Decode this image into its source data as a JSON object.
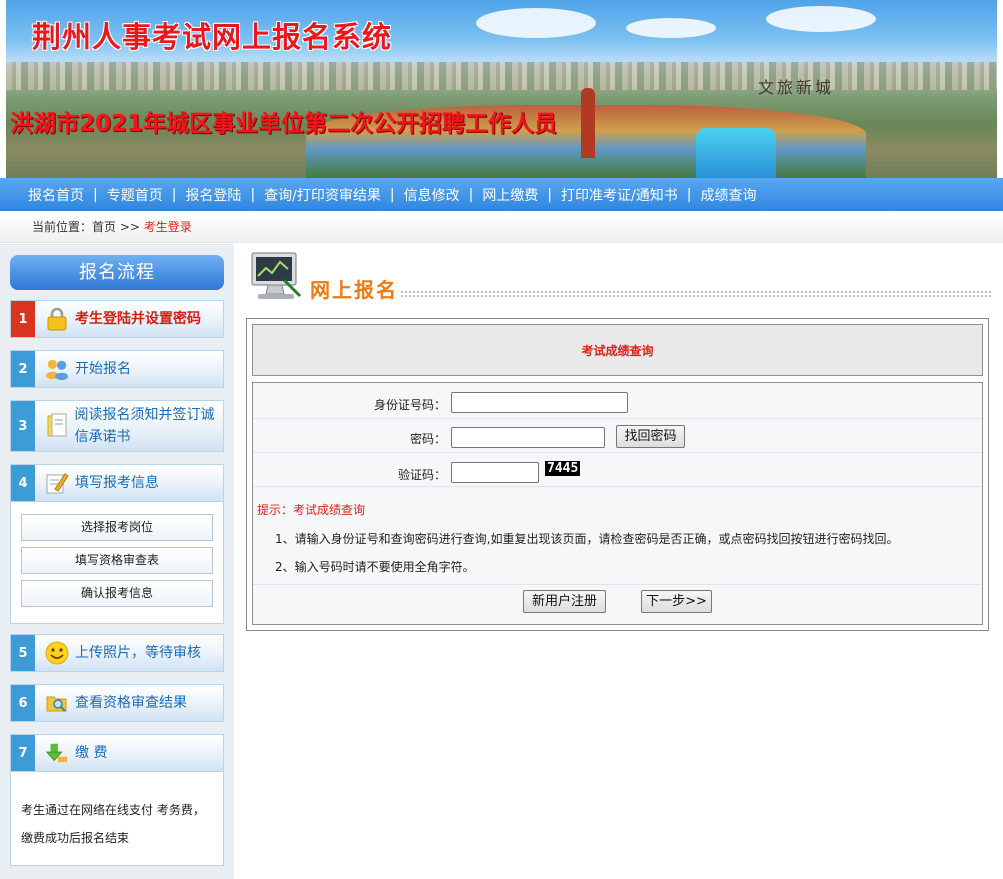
{
  "banner": {
    "system_title": "荆州人事考试网上报名系统",
    "exam_title": "洪湖市2021年城区事业单位第二次公开招聘工作人员",
    "brand_text": "文旅新城"
  },
  "nav": {
    "items": [
      "报名首页",
      "专题首页",
      "报名登陆",
      "查询/打印资审结果",
      "信息修改",
      "网上缴费",
      "打印准考证/通知书",
      "成绩查询"
    ],
    "separator": "|"
  },
  "breadcrumb": {
    "prefix": "当前位置：",
    "home": "首页",
    "arrow": " >> ",
    "current": "考生登录"
  },
  "sidebar": {
    "title": "报名流程",
    "steps": [
      {
        "num": "1",
        "label": "考生登陆并设置密码",
        "icon": "lock-icon"
      },
      {
        "num": "2",
        "label": "开始报名",
        "icon": "users-icon"
      },
      {
        "num": "3",
        "label": "阅读报名须知并签订诚信承诺书",
        "icon": "document-icon"
      },
      {
        "num": "4",
        "label": "填写报考信息",
        "icon": "edit-icon"
      },
      {
        "num": "5",
        "label": "上传照片，等待审核",
        "icon": "smiley-icon"
      },
      {
        "num": "6",
        "label": "查看资格审查结果",
        "icon": "folder-search-icon"
      },
      {
        "num": "7",
        "label": "缴 费",
        "icon": "download-arrow-icon"
      }
    ],
    "step4_buttons": [
      "选择报考岗位",
      "填写资格审查表",
      "确认报考信息"
    ],
    "pay_text": "考生通过在网络在线支付 考务费，缴费成功后报名结束"
  },
  "main": {
    "title": "网上报名",
    "panel_title": "考试成绩查询",
    "form": {
      "id_label": "身份证号码：",
      "id_value": "",
      "password_label": "密码：",
      "password_value": "",
      "find_password_button": "找回密码",
      "captcha_label": "验证码：",
      "captcha_value": "",
      "captcha_code": "7445"
    },
    "tip_label": "提示：考试成绩查询",
    "notes": [
      "1、请输入身份证号和查询密码进行查询,如重复出现该页面，请检查密码是否正确，或点密码找回按钮进行密码找回。",
      "2、输入号码时请不要使用全角字符。"
    ],
    "register_button": "新用户注册",
    "next_button": "下一步>>"
  },
  "colors": {
    "nav_blue": "#2f86e0",
    "accent_red": "#d9251b",
    "title_orange": "#f07a12",
    "step_blue": "#3d9bd6"
  }
}
